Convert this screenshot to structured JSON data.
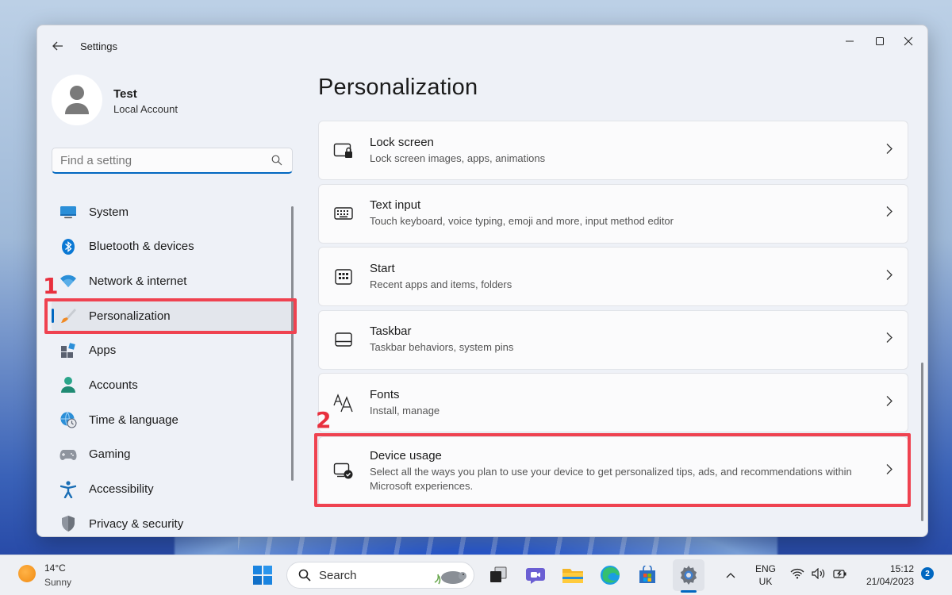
{
  "window": {
    "title": "Settings",
    "controls": {
      "minimize": "minimize",
      "maximize": "maximize",
      "close": "close"
    }
  },
  "profile": {
    "name": "Test",
    "account_type": "Local Account"
  },
  "search": {
    "placeholder": "Find a setting"
  },
  "sidebar": {
    "items": [
      {
        "label": "System",
        "icon": "monitor-icon"
      },
      {
        "label": "Bluetooth & devices",
        "icon": "bluetooth-icon"
      },
      {
        "label": "Network & internet",
        "icon": "wifi-icon"
      },
      {
        "label": "Personalization",
        "icon": "paintbrush-icon",
        "active": true
      },
      {
        "label": "Apps",
        "icon": "apps-icon"
      },
      {
        "label": "Accounts",
        "icon": "person-icon"
      },
      {
        "label": "Time & language",
        "icon": "globe-clock-icon"
      },
      {
        "label": "Gaming",
        "icon": "gamepad-icon"
      },
      {
        "label": "Accessibility",
        "icon": "accessibility-icon"
      },
      {
        "label": "Privacy & security",
        "icon": "shield-icon"
      }
    ]
  },
  "main": {
    "title": "Personalization",
    "cards": [
      {
        "title": "Lock screen",
        "desc": "Lock screen images, apps, animations",
        "icon": "lock-screen-icon"
      },
      {
        "title": "Text input",
        "desc": "Touch keyboard, voice typing, emoji and more, input method editor",
        "icon": "keyboard-icon"
      },
      {
        "title": "Start",
        "desc": "Recent apps and items, folders",
        "icon": "start-grid-icon"
      },
      {
        "title": "Taskbar",
        "desc": "Taskbar behaviors, system pins",
        "icon": "taskbar-icon"
      },
      {
        "title": "Fonts",
        "desc": "Install, manage",
        "icon": "fonts-icon"
      },
      {
        "title": "Device usage",
        "desc": "Select all the ways you plan to use your device to get personalized tips, ads, and recommendations within Microsoft experiences.",
        "icon": "device-usage-icon"
      }
    ]
  },
  "annotations": {
    "step1": "1",
    "step2": "2",
    "color": "#ef4250"
  },
  "taskbar": {
    "weather": {
      "temp": "14°C",
      "condition": "Sunny"
    },
    "search_label": "Search",
    "apps": [
      "start-icon",
      "search-icon",
      "task-view-icon",
      "teams-chat-icon",
      "file-explorer-icon",
      "edge-icon",
      "store-icon",
      "settings-icon"
    ],
    "language": {
      "line1": "ENG",
      "line2": "UK"
    },
    "clock": {
      "time": "15:12",
      "date": "21/04/2023"
    },
    "notifications": "2"
  },
  "colors": {
    "accent": "#0067c0",
    "annotation": "#ef4250"
  }
}
